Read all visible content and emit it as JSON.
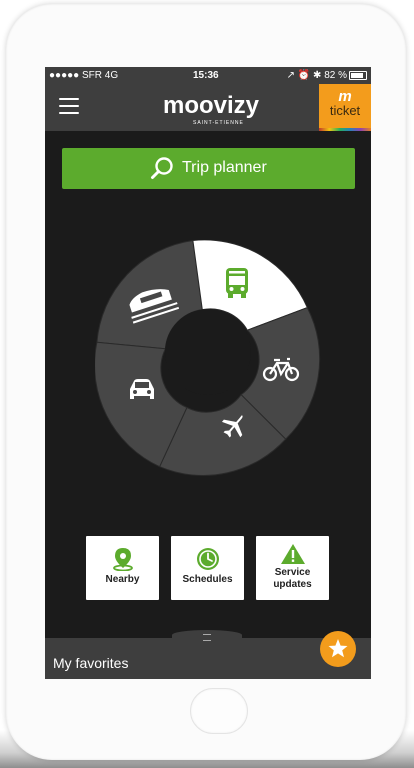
{
  "status_bar": {
    "carrier": "●●●●● SFR  4G",
    "time": "15:36",
    "right": "↗ ⏰ ✱ 82 %"
  },
  "header": {
    "logo_text": "moovizy",
    "logo_subtitle": "SAINT-ETIENNE",
    "ticket_m": "m",
    "ticket_label": "ticket"
  },
  "trip_planner": {
    "label": "Trip planner"
  },
  "modes": [
    {
      "name": "bus",
      "icon": "bus-icon",
      "selected": true
    },
    {
      "name": "bike",
      "icon": "bike-icon",
      "selected": false
    },
    {
      "name": "plane",
      "icon": "plane-icon",
      "selected": false
    },
    {
      "name": "car",
      "icon": "car-icon",
      "selected": false
    },
    {
      "name": "train",
      "icon": "train-icon",
      "selected": false
    }
  ],
  "tiles": [
    {
      "label": "Nearby",
      "icon": "location-pin-icon"
    },
    {
      "label": "Schedules",
      "icon": "clock-icon"
    },
    {
      "label": "Service updates",
      "icon": "warning-icon"
    }
  ],
  "favorites": {
    "label": "My favorites",
    "icon": "star-icon"
  },
  "colors": {
    "accent_green": "#5cab2d",
    "accent_orange": "#f39c1c",
    "bar_gray": "#3e3e3e",
    "screen_bg": "#1b1b1b",
    "segment_gray": "#474747"
  }
}
